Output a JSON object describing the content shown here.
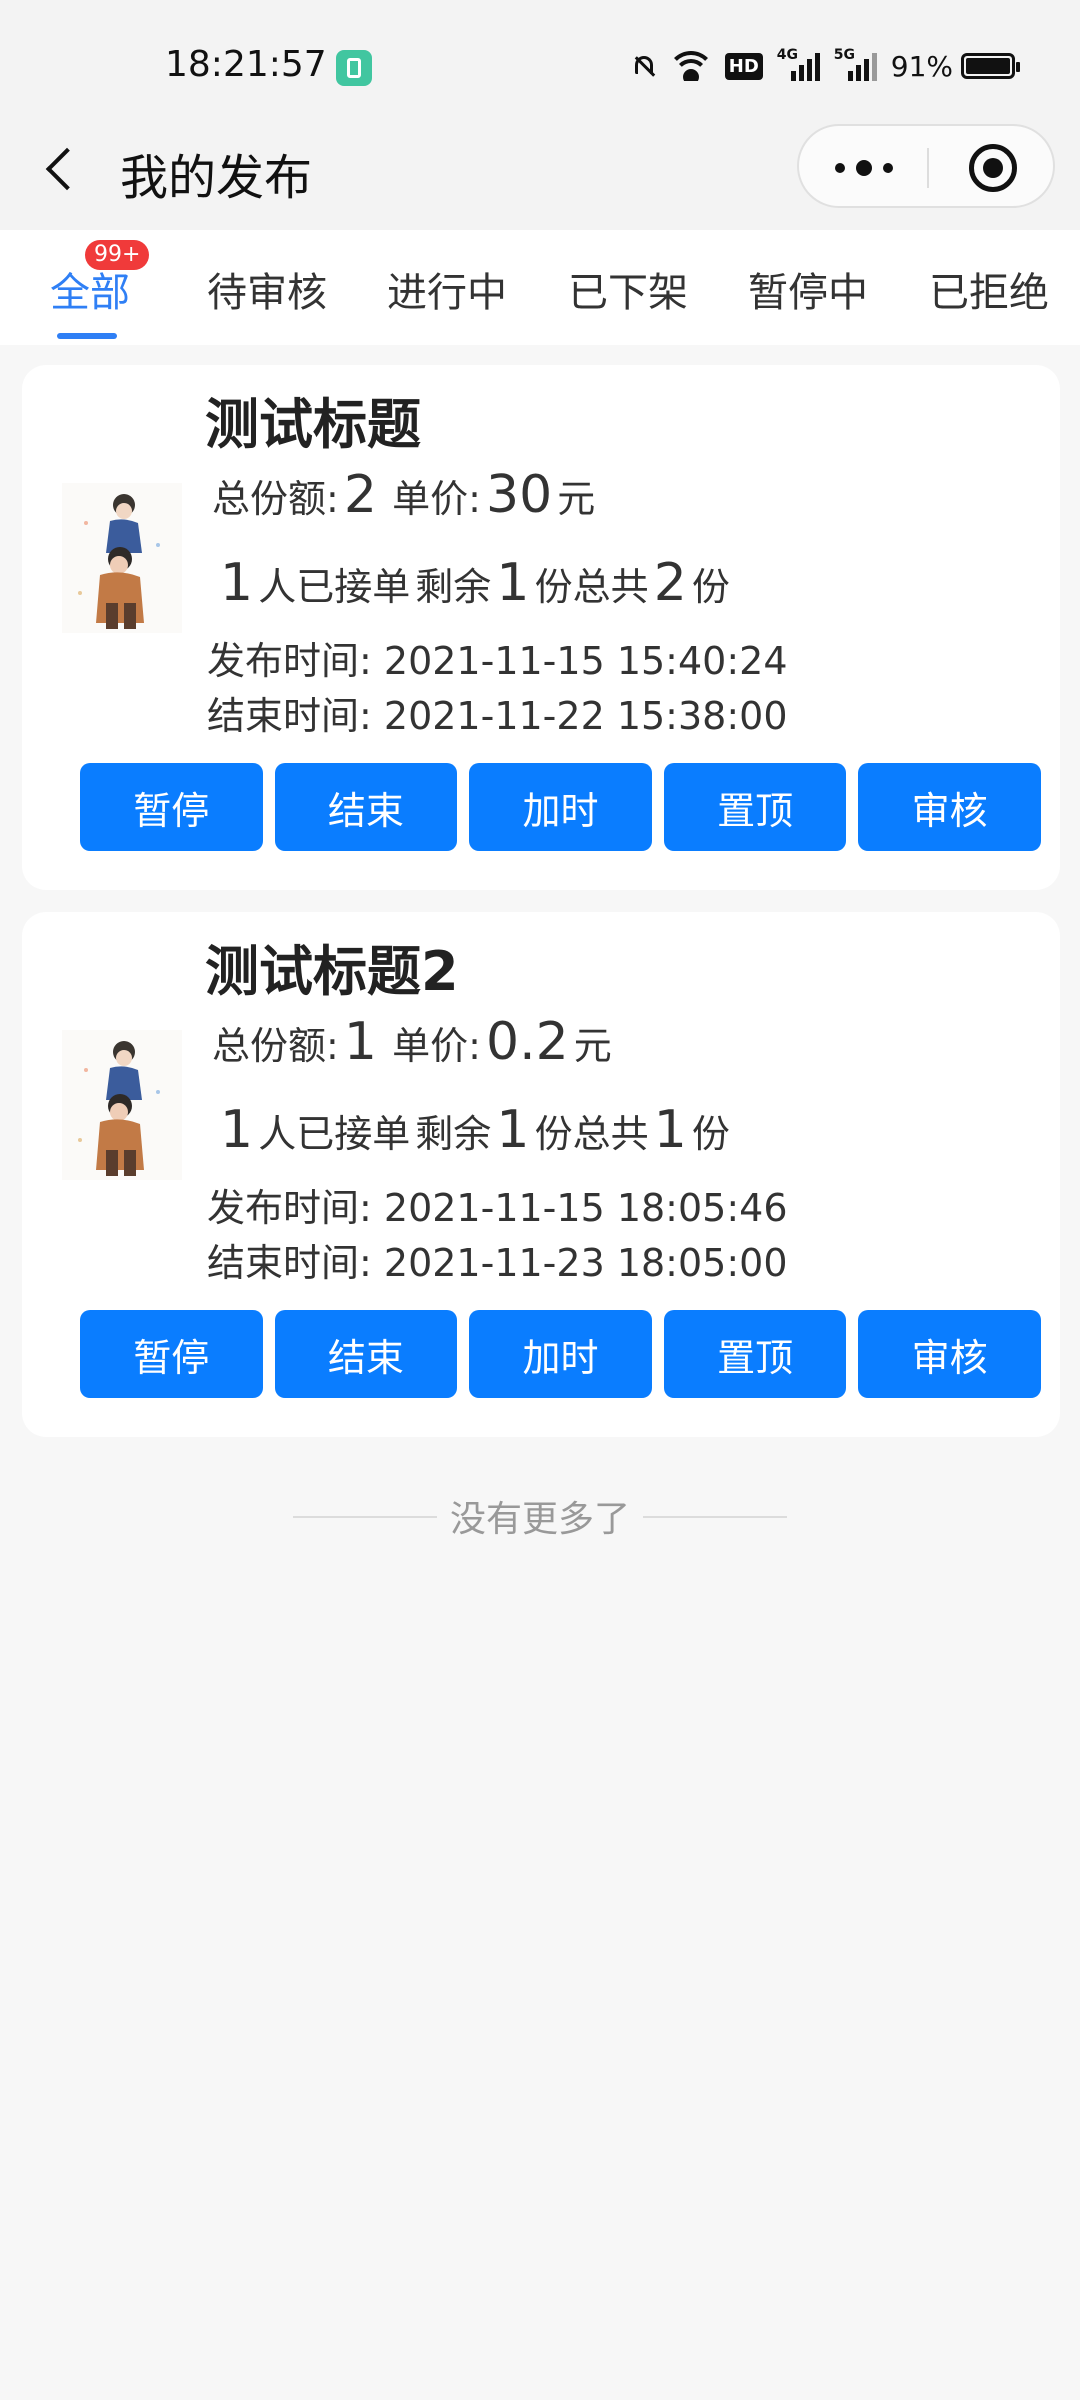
{
  "status_bar": {
    "time": "18:21:57",
    "app_icon": "mini-program-icon",
    "icons": [
      "mute-bell-icon",
      "wifi-icon",
      "hd-icon",
      "signal-4g-icon",
      "signal-5g-icon"
    ],
    "hd_label": "HD",
    "signal_4g_label": "4G",
    "signal_5g_label": "5G",
    "battery": "91%"
  },
  "nav": {
    "title": "我的发布",
    "back_icon": "back-arrow-icon",
    "more_icon": "more-dots-icon",
    "close_icon": "target-circle-icon"
  },
  "tabs": {
    "items": [
      {
        "label": "全部",
        "active": true,
        "badge": "99+"
      },
      {
        "label": "待审核"
      },
      {
        "label": "进行中"
      },
      {
        "label": "已下架"
      },
      {
        "label": "暂停中"
      },
      {
        "label": "已拒绝"
      }
    ],
    "accent": "#2f7ff5",
    "badge_color": "#f03a3a"
  },
  "labels": {
    "total_shares": "总份额:",
    "unit_price": "单价:",
    "yuan": "元",
    "people_accepted": "人已接单",
    "remaining": "剩余",
    "shares_total": "份总共",
    "shares": "份",
    "publish_time": "发布时间:",
    "end_time": "结束时间:"
  },
  "posts": [
    {
      "title": "测试标题",
      "total_shares": "2",
      "unit_price": "30",
      "accepted": "1",
      "remaining": "1",
      "total": "2",
      "publish_time": "2021-11-15 15:40:24",
      "end_time": "2021-11-22 15:38:00",
      "buttons": [
        "暂停",
        "结束",
        "加时",
        "置顶",
        "审核"
      ]
    },
    {
      "title": "测试标题2",
      "total_shares": "1",
      "unit_price": "0.2",
      "accepted": "1",
      "remaining": "1",
      "total": "1",
      "publish_time": "2021-11-15 18:05:46",
      "end_time": "2021-11-23 18:05:00",
      "buttons": [
        "暂停",
        "结束",
        "加时",
        "置顶",
        "审核"
      ]
    }
  ],
  "button_color": "#0a7dff",
  "footer": {
    "no_more": "没有更多了"
  }
}
